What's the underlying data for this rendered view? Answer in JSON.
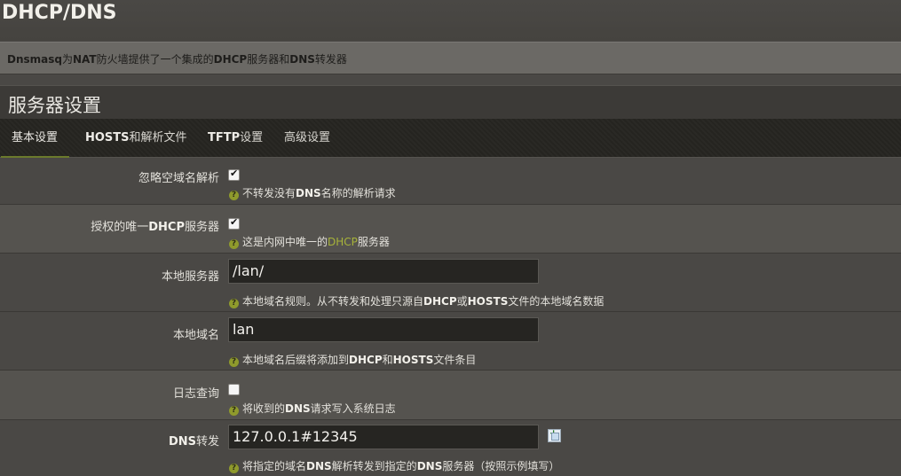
{
  "page": {
    "title": "DHCP/DNS",
    "description_parts": [
      {
        "text": "Dnsmasq",
        "bold": true
      },
      {
        "text": "为",
        "bold": false
      },
      {
        "text": "NAT",
        "bold": true
      },
      {
        "text": "防火墙提供了一个集成的",
        "bold": false
      },
      {
        "text": "DHCP",
        "bold": true
      },
      {
        "text": "服务器和",
        "bold": false
      },
      {
        "text": "DNS",
        "bold": true
      },
      {
        "text": "转发器",
        "bold": false
      }
    ]
  },
  "section": {
    "title": "服务器设置"
  },
  "tabs": [
    {
      "parts": [
        {
          "text": "基本设置",
          "bold": false
        }
      ],
      "active": true
    },
    {
      "parts": [
        {
          "text": "HOSTS",
          "bold": true
        },
        {
          "text": "和解析文件",
          "bold": false
        }
      ],
      "active": false
    },
    {
      "parts": [
        {
          "text": "TFTP",
          "bold": true
        },
        {
          "text": "设置",
          "bold": false
        }
      ],
      "active": false
    },
    {
      "parts": [
        {
          "text": "高级设置",
          "bold": false
        }
      ],
      "active": false
    }
  ],
  "fields": {
    "domainneeded": {
      "label_parts": [
        {
          "text": "忽略空域名解析",
          "bold": false
        }
      ],
      "checked": true,
      "help_parts": [
        {
          "text": "不转发没有",
          "style": ""
        },
        {
          "text": "DNS",
          "style": "bold"
        },
        {
          "text": "名称的解析请求",
          "style": ""
        }
      ]
    },
    "authoritative": {
      "label_parts": [
        {
          "text": "授权的唯一",
          "bold": false
        },
        {
          "text": "DHCP",
          "bold": true
        },
        {
          "text": "服务器",
          "bold": false
        }
      ],
      "checked": true,
      "help_parts": [
        {
          "text": "这是内网中唯一的",
          "style": ""
        },
        {
          "text": "DHCP",
          "style": "hl"
        },
        {
          "text": "服务器",
          "style": ""
        }
      ]
    },
    "local": {
      "label_parts": [
        {
          "text": "本地服务器",
          "bold": false
        }
      ],
      "value": "/lan/",
      "help_parts": [
        {
          "text": "本地域名规则。从不转发和处理只源自",
          "style": ""
        },
        {
          "text": "DHCP",
          "style": "bold"
        },
        {
          "text": "或",
          "style": ""
        },
        {
          "text": "HOSTS",
          "style": "bold"
        },
        {
          "text": "文件的本地域名数据",
          "style": ""
        }
      ]
    },
    "domain": {
      "label_parts": [
        {
          "text": "本地域名",
          "bold": false
        }
      ],
      "value": "lan",
      "help_parts": [
        {
          "text": "本地域名后缀将添加到",
          "style": ""
        },
        {
          "text": "DHCP",
          "style": "bold"
        },
        {
          "text": "和",
          "style": ""
        },
        {
          "text": "HOSTS",
          "style": "bold"
        },
        {
          "text": "文件条目",
          "style": ""
        }
      ]
    },
    "logqueries": {
      "label_parts": [
        {
          "text": "日志查询",
          "bold": false
        }
      ],
      "checked": false,
      "help_parts": [
        {
          "text": "将收到的",
          "style": ""
        },
        {
          "text": "DNS",
          "style": "bold"
        },
        {
          "text": "请求写入系统日志",
          "style": ""
        }
      ]
    },
    "server": {
      "label_parts": [
        {
          "text": "DNS",
          "bold": true
        },
        {
          "text": "转发",
          "bold": false
        }
      ],
      "value": "127.0.0.1#12345",
      "help_parts": [
        {
          "text": "将指定的域名",
          "style": ""
        },
        {
          "text": "DNS",
          "style": "bold"
        },
        {
          "text": "解析转发到指定的",
          "style": ""
        },
        {
          "text": "DNS",
          "style": "bold"
        },
        {
          "text": "服务器（按照示例填写）",
          "style": ""
        }
      ]
    }
  },
  "icons": {
    "help": "help-icon",
    "add": "add-entry-icon"
  },
  "colors": {
    "accent": "#6b7a2c",
    "help_icon": "#8f9a2c",
    "highlight": "#a7b33a"
  }
}
